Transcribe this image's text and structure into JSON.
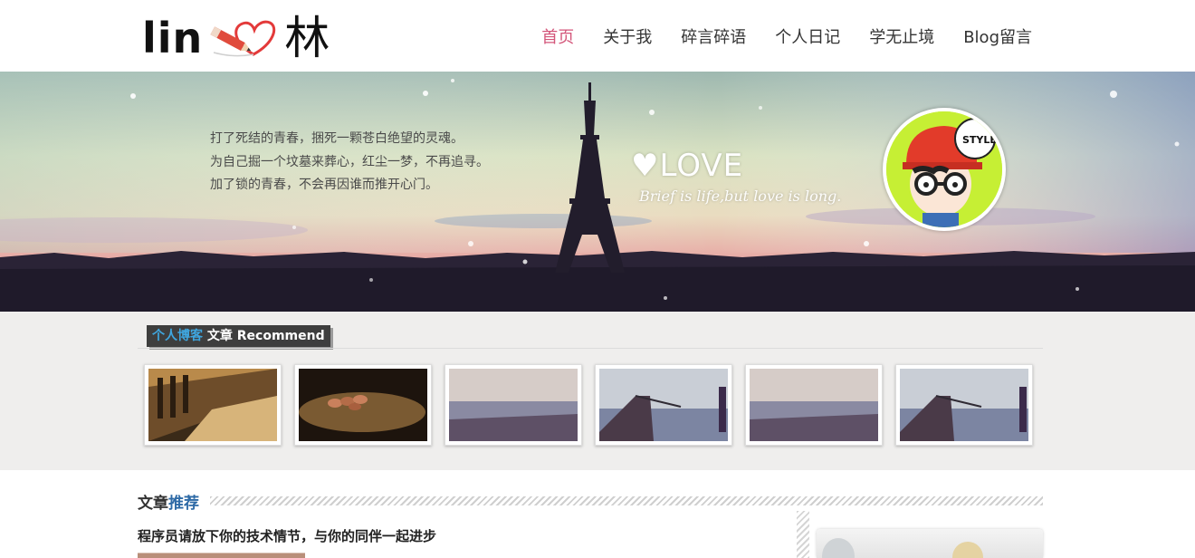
{
  "header": {
    "logo_text": "lin",
    "logo_char": "林",
    "nav": [
      {
        "label": "首页",
        "active": true
      },
      {
        "label": "关于我",
        "active": false
      },
      {
        "label": "碎言碎语",
        "active": false
      },
      {
        "label": "个人日记",
        "active": false
      },
      {
        "label": "学无止境",
        "active": false
      },
      {
        "label": "Blog留言",
        "active": false
      }
    ]
  },
  "banner": {
    "poem": [
      "打了死结的青春，捆死一颗苍白绝望的灵魂。",
      "为自己掘一个坟墓来葬心，红尘一梦，不再追寻。",
      "加了锁的青春，不会再因谁而推开心门。"
    ],
    "love_word": "♥LOVE",
    "love_sub": "Brief is life,but love is long.",
    "avatar_badge": "STYLE"
  },
  "recommend": {
    "title_highlight": "个人博客",
    "title_rest": "文章 Recommend",
    "thumbs": [
      "books",
      "stones",
      "beach",
      "boat",
      "beach",
      "boat"
    ]
  },
  "articles": {
    "heading_plain": "文章",
    "heading_highlight": "推荐",
    "first_title": "程序员请放下你的技术情节，与你的同伴一起进步"
  },
  "colors": {
    "nav_active": "#d3567a",
    "title_highlight": "#3fa7e0",
    "heading_highlight": "#2e6aa6"
  }
}
